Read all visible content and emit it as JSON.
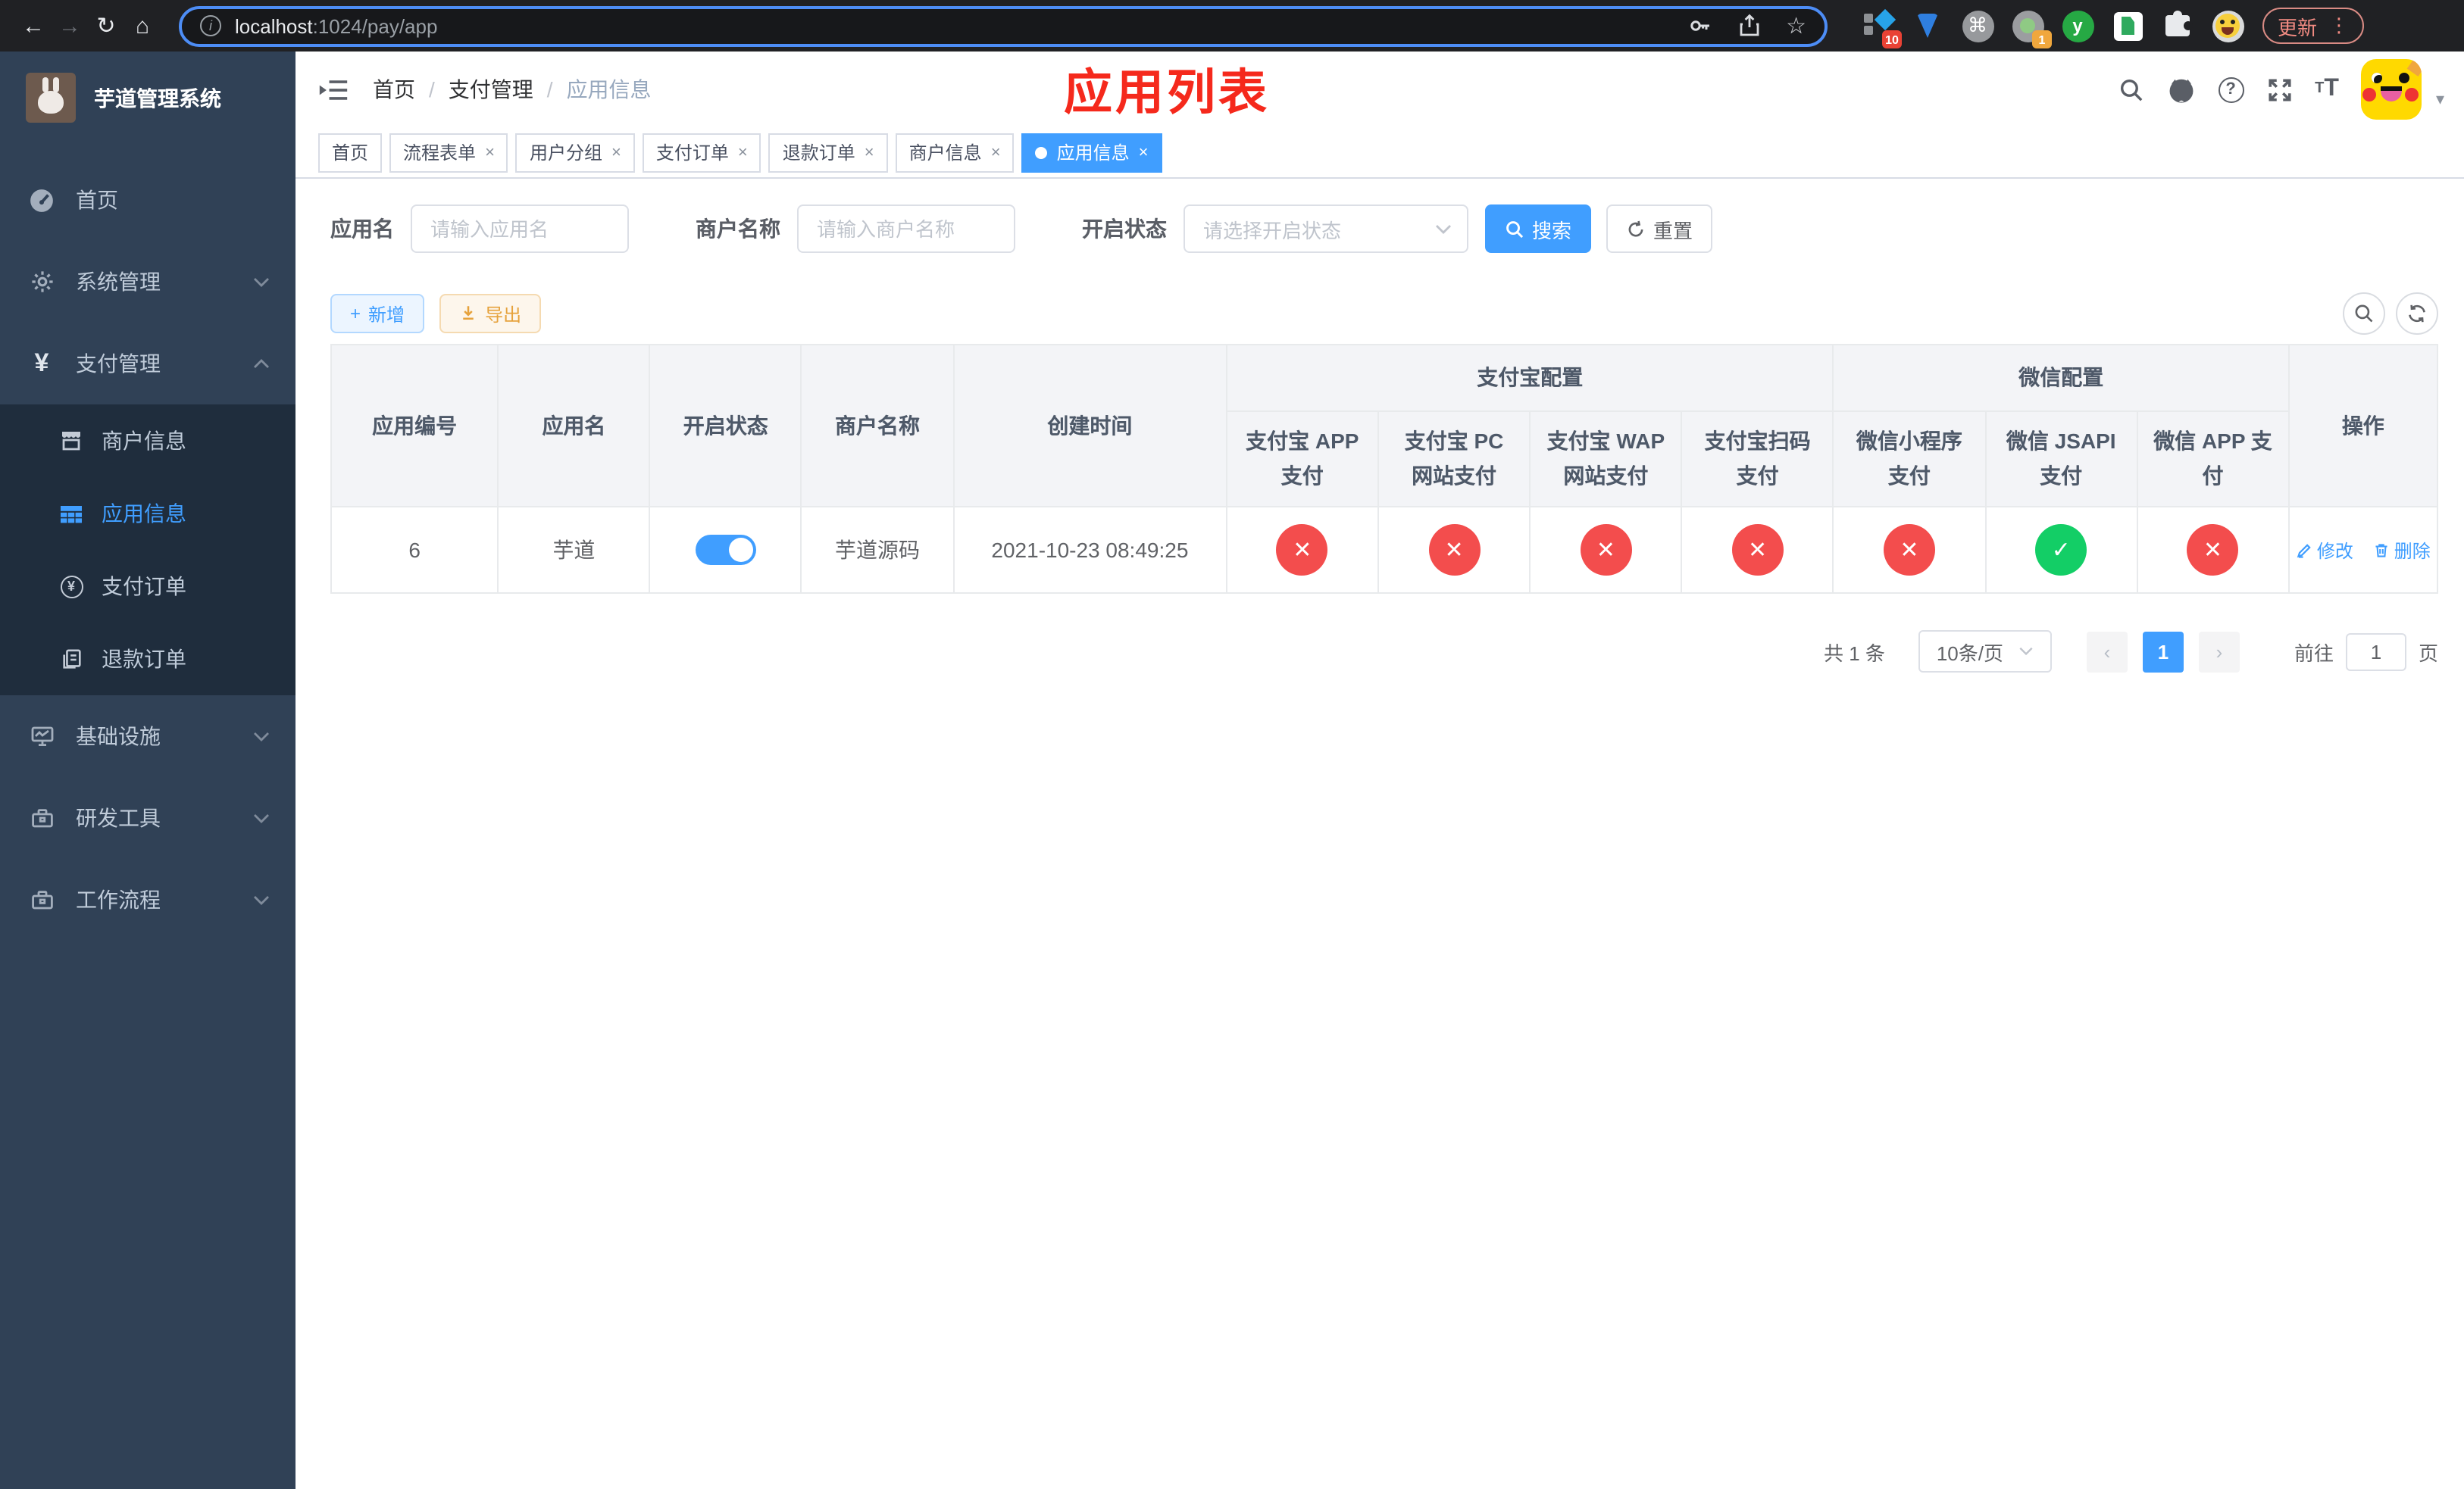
{
  "browser": {
    "url_host": "localhost",
    "url_path": ":1024/pay/app",
    "update_label": "更新",
    "ext_badge_blue_diamond": "10",
    "ext_badge_circle": "1",
    "ext_y_label": "y"
  },
  "sidebar": {
    "logo_title": "芋道管理系统",
    "items": [
      {
        "label": "首页"
      },
      {
        "label": "系统管理"
      },
      {
        "label": "支付管理"
      },
      {
        "label": "基础设施"
      },
      {
        "label": "研发工具"
      },
      {
        "label": "工作流程"
      }
    ],
    "submenu": [
      {
        "label": "商户信息"
      },
      {
        "label": "应用信息"
      },
      {
        "label": "支付订单"
      },
      {
        "label": "退款订单"
      }
    ]
  },
  "header": {
    "breadcrumb": [
      "首页",
      "支付管理",
      "应用信息"
    ],
    "annotation": "应用列表"
  },
  "tabs": [
    {
      "label": "首页"
    },
    {
      "label": "流程表单"
    },
    {
      "label": "用户分组"
    },
    {
      "label": "支付订单"
    },
    {
      "label": "退款订单"
    },
    {
      "label": "商户信息"
    },
    {
      "label": "应用信息"
    }
  ],
  "filters": {
    "app_name_label": "应用名",
    "app_name_placeholder": "请输入应用名",
    "merchant_label": "商户名称",
    "merchant_placeholder": "请输入商户名称",
    "status_label": "开启状态",
    "status_placeholder": "请选择开启状态",
    "search_label": "搜索",
    "reset_label": "重置"
  },
  "toolbar": {
    "add_label": "新增",
    "export_label": "导出"
  },
  "table": {
    "col_headers": [
      "应用编号",
      "应用名",
      "开启状态",
      "商户名称",
      "创建时间"
    ],
    "group_alipay": "支付宝配置",
    "group_wechat": "微信配置",
    "alipay_cols": [
      "支付宝 APP 支付",
      "支付宝 PC 网站支付",
      "支付宝 WAP 网站支付",
      "支付宝扫码支付"
    ],
    "wechat_cols": [
      "微信小程序支付",
      "微信 JSAPI 支付",
      "微信 APP 支付"
    ],
    "action_header": "操作",
    "row": {
      "id": "6",
      "name": "芋道",
      "enabled": true,
      "merchant": "芋道源码",
      "created": "2021-10-23 08:49:25",
      "channels": [
        "fail",
        "fail",
        "fail",
        "fail",
        "fail",
        "ok",
        "fail"
      ],
      "edit_label": "修改",
      "delete_label": "删除"
    }
  },
  "pagination": {
    "total": "共 1 条",
    "page_size": "10条/页",
    "current_page": "1",
    "goto_label": "前往",
    "goto_value": "1",
    "unit_label": "页"
  },
  "colors": {
    "accent": "#409eff",
    "status_fail": "#f34d4d",
    "status_ok": "#13ce66",
    "annotation_red": "#f5291c",
    "sidebar_bg": "#304156",
    "submenu_bg": "#1f2d3d"
  },
  "icons": {
    "nav": [
      "back-icon",
      "forward-icon",
      "reload-icon",
      "home-icon"
    ],
    "url": [
      "info-icon",
      "key-icon",
      "share-icon",
      "star-icon"
    ],
    "navbar": [
      "search-icon",
      "github-icon",
      "help-icon",
      "fullscreen-icon",
      "font-size-icon"
    ]
  }
}
